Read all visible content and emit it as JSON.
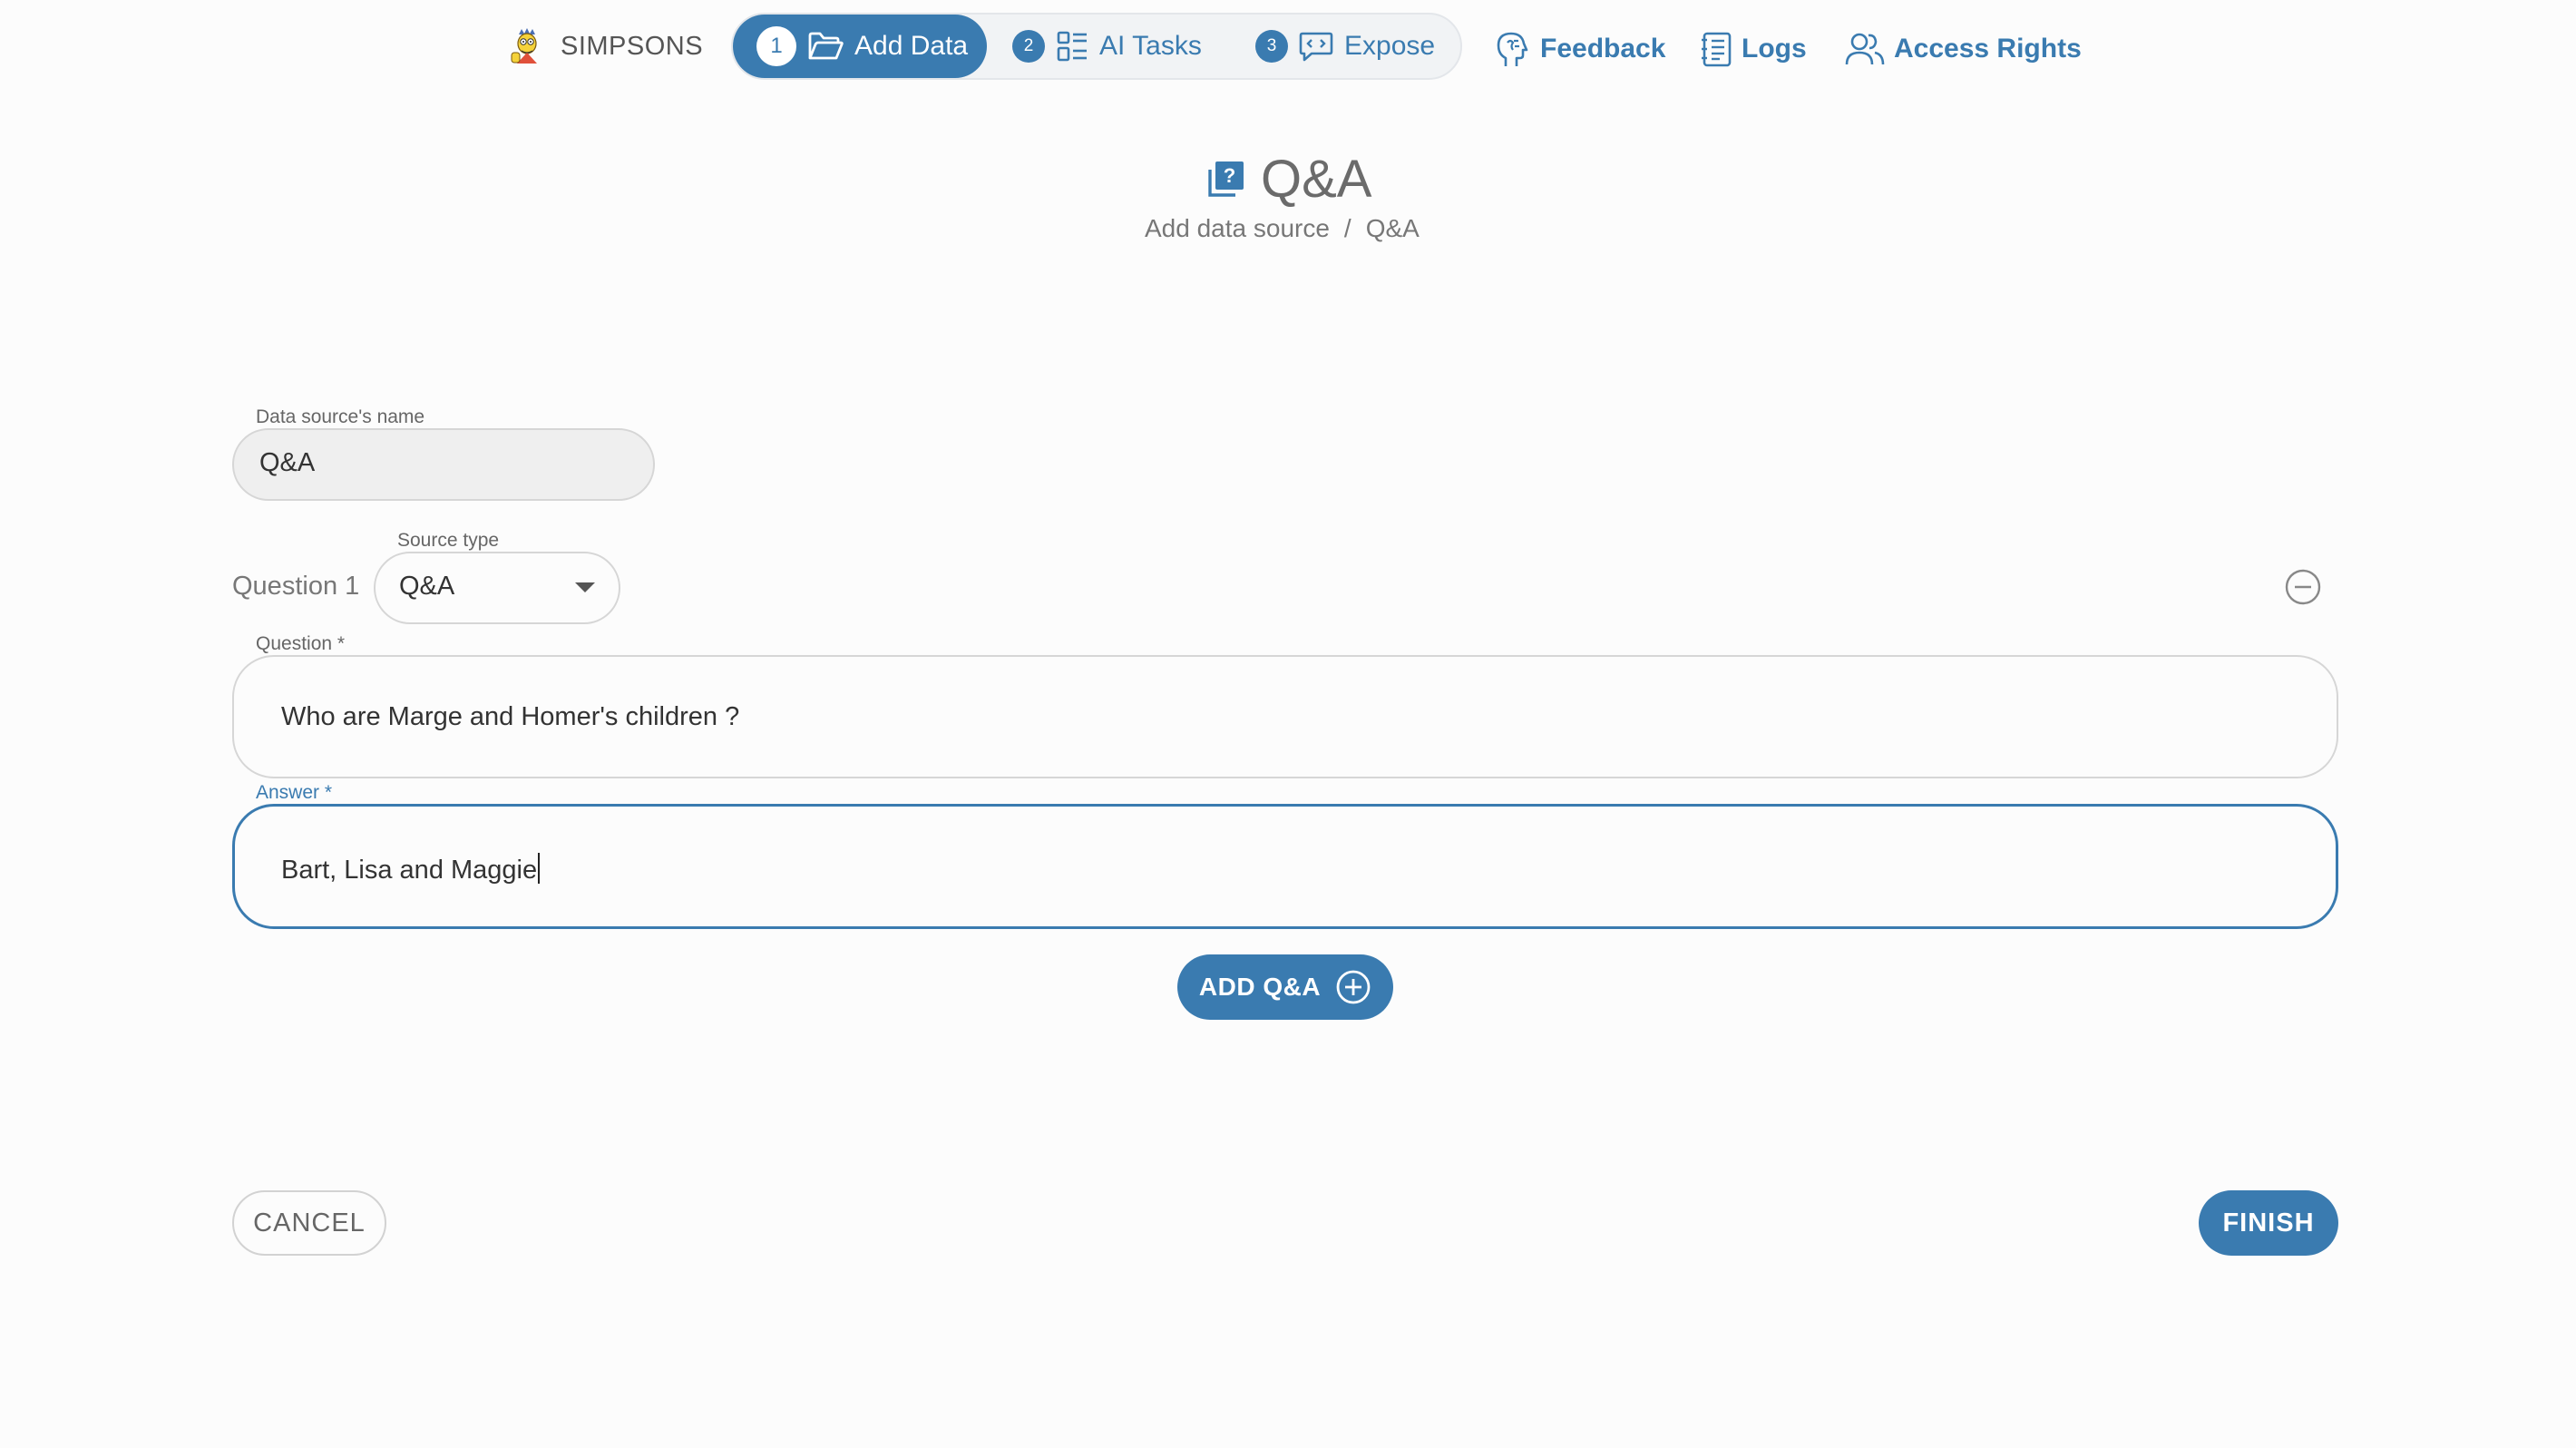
{
  "colors": {
    "accent": "#3a7bb0",
    "background": "#fcfcfc"
  },
  "brand": {
    "name": "SIMPSONS",
    "logo_icon": "simpsons-logo-icon"
  },
  "stepper": {
    "steps": [
      {
        "number": "1",
        "label": "Add Data",
        "icon": "folder-open-icon",
        "active": true
      },
      {
        "number": "2",
        "label": "AI Tasks",
        "icon": "tasks-list-icon",
        "active": false
      },
      {
        "number": "3",
        "label": "Expose",
        "icon": "code-chat-icon",
        "active": false
      }
    ]
  },
  "nav": {
    "feedback": {
      "label": "Feedback",
      "icon": "feedback-head-icon"
    },
    "logs": {
      "label": "Logs",
      "icon": "logs-document-icon"
    },
    "access_rights": {
      "label": "Access Rights",
      "icon": "users-icon"
    }
  },
  "page": {
    "title": "Q&A",
    "title_icon": "qa-library-icon",
    "breadcrumb": {
      "parent": "Add data source",
      "separator": "/",
      "current": "Q&A"
    }
  },
  "form": {
    "data_source_name": {
      "label": "Data source's name",
      "value": "Q&A"
    },
    "question_index_label": "Question 1",
    "source_type": {
      "label": "Source type",
      "value": "Q&A"
    },
    "question": {
      "label": "Question *",
      "value": "Who are Marge and Homer's children ?"
    },
    "answer": {
      "label": "Answer *",
      "value": "Bart, Lisa and Maggie"
    }
  },
  "buttons": {
    "add_qa": "ADD Q&A",
    "cancel": "CANCEL",
    "finish": "FINISH"
  }
}
